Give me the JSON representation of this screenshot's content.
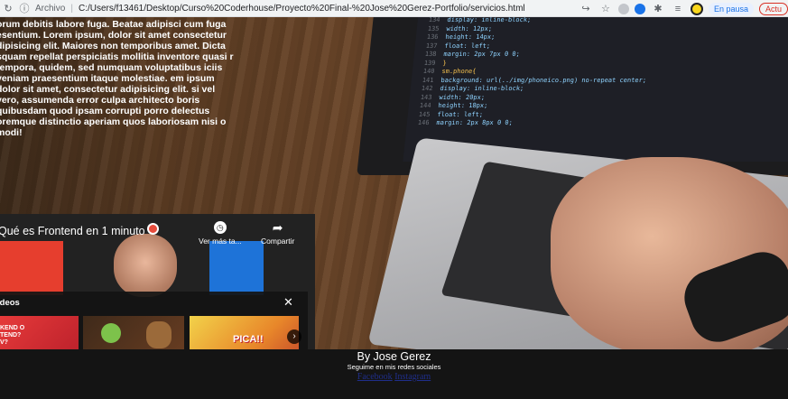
{
  "browser": {
    "site_label": "Archivo",
    "url": "C:/Users/f13461/Desktop/Curso%20Coderhouse/Proyecto%20Final-%20Jose%20Gerez-Portfolio/servicios.html",
    "pause_label": "En pausa",
    "update_label": "Actu"
  },
  "hero": {
    "paragraph": "orum debitis labore fuga. Beatae adipisci cum fuga esentium. Lorem ipsum, dolor sit amet consectetur dipisicing elit. Maiores non temporibus amet. Dicta squam repellat perspiciatis mollitia inventore quasi r tempora, quidem, sed numquam voluptatibus iciis veniam praesentium itaque molestiae. em ipsum dolor sit amet, consectetur adipisicing elit. si vel vero, assumenda error culpa architecto boris quibusdam quod ipsam corrupti porro delectus oremque distinctio aperiam quos laboriosam nisi o modi!"
  },
  "code_lines": [
    {
      "num": "134",
      "text": "display: inline-block;"
    },
    {
      "num": "135",
      "text": "width: 12px;"
    },
    {
      "num": "136",
      "text": "height: 14px;"
    },
    {
      "num": "137",
      "text": "float: left;"
    },
    {
      "num": "138",
      "text": "margin: 2px 7px 0 0;"
    },
    {
      "num": "139",
      "text": "}"
    },
    {
      "num": "140",
      "text": "sm.phone{"
    },
    {
      "num": "141",
      "text": "background: url(../img/phoneico.png) no-repeat center;"
    },
    {
      "num": "142",
      "text": "display: inline-block;"
    },
    {
      "num": "143",
      "text": "width: 20px;"
    },
    {
      "num": "144",
      "text": "height: 18px;"
    },
    {
      "num": "145",
      "text": "float: left;"
    },
    {
      "num": "146",
      "text": "margin: 2px 8px 0 0;"
    }
  ],
  "video": {
    "title": "Qué es Frontend en 1 minuto",
    "watch_later": "Ver más ta...",
    "share": "Compartir",
    "more_videos": "ídeos",
    "thumb1_text": "KEND O\nTEND?\nV?",
    "thumb3_text": "PICA!!"
  },
  "footer": {
    "name": "By Jose Gerez",
    "subtitle": "Seguime en mis redes sociales",
    "links": [
      "Facebook",
      "Instagram"
    ]
  }
}
